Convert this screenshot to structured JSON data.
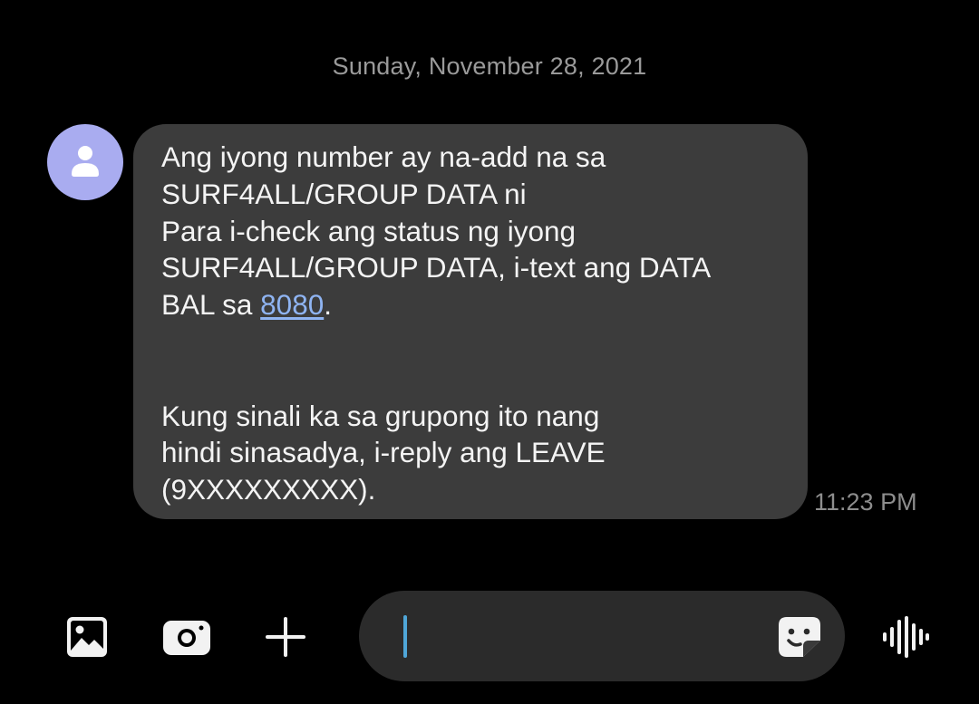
{
  "conversation": {
    "date_header": "Sunday, November 28, 2021"
  },
  "contact": {
    "avatar_icon": "person-icon",
    "avatar_color": "#a9acf0"
  },
  "message": {
    "lines": [
      "Ang iyong number ay na-add na sa",
      "SURF4ALL/GROUP DATA ni",
      "Para i-check ang status ng iyong",
      "SURF4ALL/GROUP DATA, i-text ang DATA"
    ],
    "line5_prefix": "BAL sa ",
    "link_number": "8080",
    "line5_suffix": ".",
    "lines_after": [
      "Kung sinali ka sa grupong ito nang",
      "hindi sinasadya, i-reply ang LEAVE",
      "(9XXXXXXXXX)."
    ],
    "timestamp": "11:23 PM",
    "bubble_color": "#3c3c3c",
    "link_color": "#8fb4f2"
  },
  "toolbar": {
    "gallery_icon": "gallery-icon",
    "camera_icon": "camera-icon",
    "add_icon": "plus-icon",
    "composer_value": "",
    "composer_placeholder": "",
    "sticker_icon": "sticker-icon",
    "voice_icon": "voice-waveform-icon",
    "cursor_color": "#4fa6d8"
  }
}
